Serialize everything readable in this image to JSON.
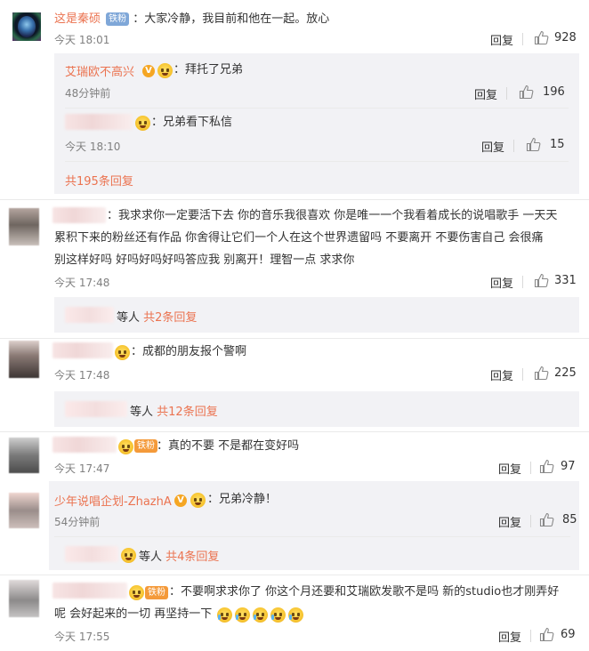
{
  "comments": [
    {
      "user": "这是秦硕",
      "badge": "铁粉",
      "text": "：大家冷静，我目前和他在一起。放心",
      "time": "今天 18:01",
      "reply": "回复",
      "likes": "928",
      "subreplies": [
        {
          "user": "艾瑞欧不高兴",
          "text": "：拜托了兄弟",
          "time": "48分钟前",
          "reply": "回复",
          "likes": "196"
        },
        {
          "user": "",
          "text": "：兄弟看下私信",
          "time": "今天 18:10",
          "reply": "回复",
          "likes": "15"
        }
      ],
      "more": "共195条回复"
    },
    {
      "text_line1": "：我求求你一定要活下去 你的音乐我很喜欢 你是唯一一个我看着成长的说唱歌手 一天天",
      "text_line2": "累积下来的粉丝还有作品 你舍得让它们一个人在这个世界遗留吗 不要离开 不要伤害自己 会很痛",
      "text_line3": "别这样好吗 好吗好吗好吗答应我 别离开！理智一点 求求你",
      "time": "今天 17:48",
      "reply": "回复",
      "likes": "331",
      "more_prefix": "等人",
      "more": "共2条回复"
    },
    {
      "text": "：成都的朋友报个警啊",
      "time": "今天 17:48",
      "reply": "回复",
      "likes": "225",
      "more_prefix": "等人",
      "more": "共12条回复"
    },
    {
      "badge": "铁粉",
      "text": "：真的不要 不是都在变好吗",
      "time": "今天 17:47",
      "reply": "回复",
      "likes": "97",
      "subreplies": [
        {
          "user": "少年说唱企划-ZhazhA",
          "text": "：兄弟冷静！",
          "time": "54分钟前",
          "reply": "回复",
          "likes": "85"
        }
      ],
      "more_prefix": "等人",
      "more": "共4条回复"
    },
    {
      "badge": "铁粉",
      "text_line1": "：不要啊求求你了 你这个月还要和艾瑞欧发歌不是吗 新的studio也才刚弄好",
      "text_line2": "呢 会好起来的一切 再坚持一下",
      "time": "今天 17:55",
      "reply": "回复",
      "likes": "69"
    }
  ],
  "icons": {
    "like": "thumbs-up-icon",
    "vip": "vip-v-icon",
    "crown": "crown-icon",
    "emoji": "crying-emoji-icon"
  },
  "colors": {
    "username": "#eb7350",
    "badge_blue": "#7fa7d8",
    "badge_orange": "#f49a3a",
    "sub_bg": "#f2f2f5"
  }
}
